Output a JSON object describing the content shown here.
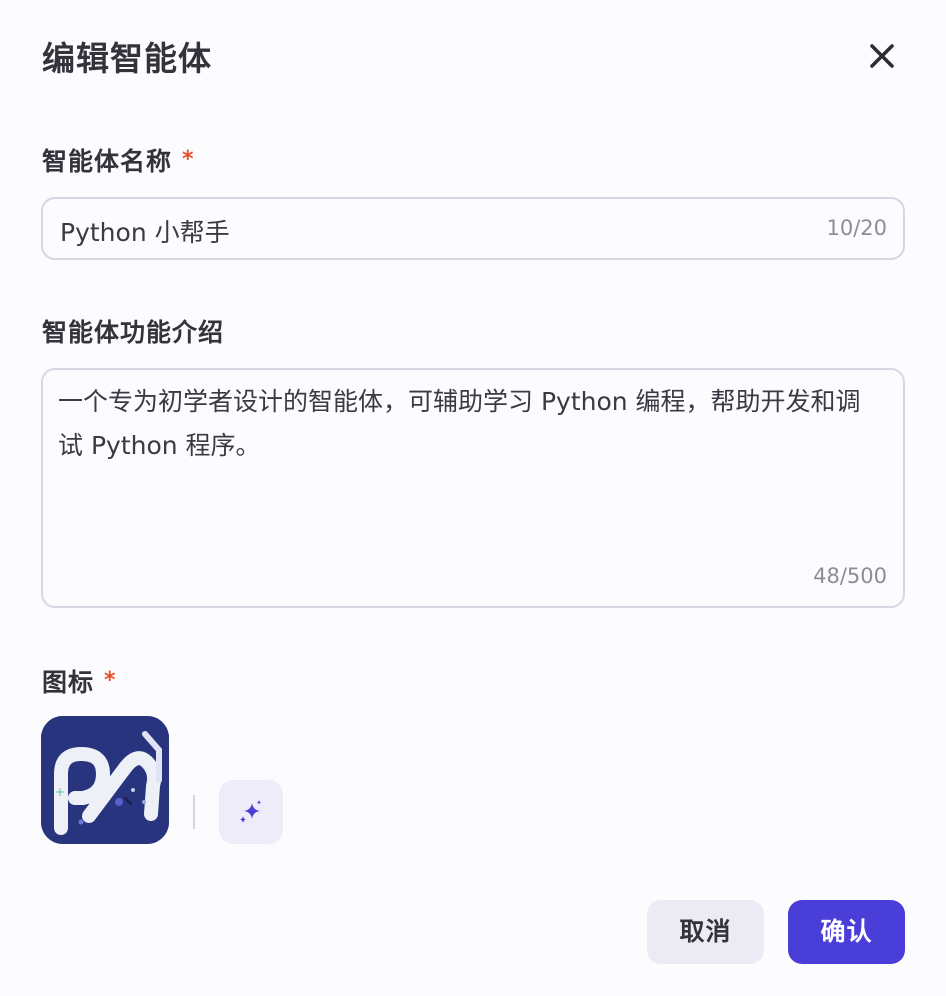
{
  "dialog": {
    "title": "编辑智能体",
    "close_icon": "close-icon"
  },
  "name_field": {
    "label": "智能体名称",
    "required_mark": "*",
    "value": "Python 小帮手",
    "count": "10/20"
  },
  "description_field": {
    "label": "智能体功能介绍",
    "value": "一个专为初学者设计的智能体，可辅助学习 Python 编程，帮助开发和调试 Python 程序。",
    "count": "48/500"
  },
  "icon_field": {
    "label": "图标",
    "required_mark": "*",
    "avatar_icon": "agent-avatar-icon",
    "generate_icon": "sparkle-icon"
  },
  "footer": {
    "cancel_label": "取消",
    "confirm_label": "确认"
  },
  "colors": {
    "accent": "#4a3ed9",
    "required": "#e5502b",
    "avatar_bg": "#263277"
  }
}
